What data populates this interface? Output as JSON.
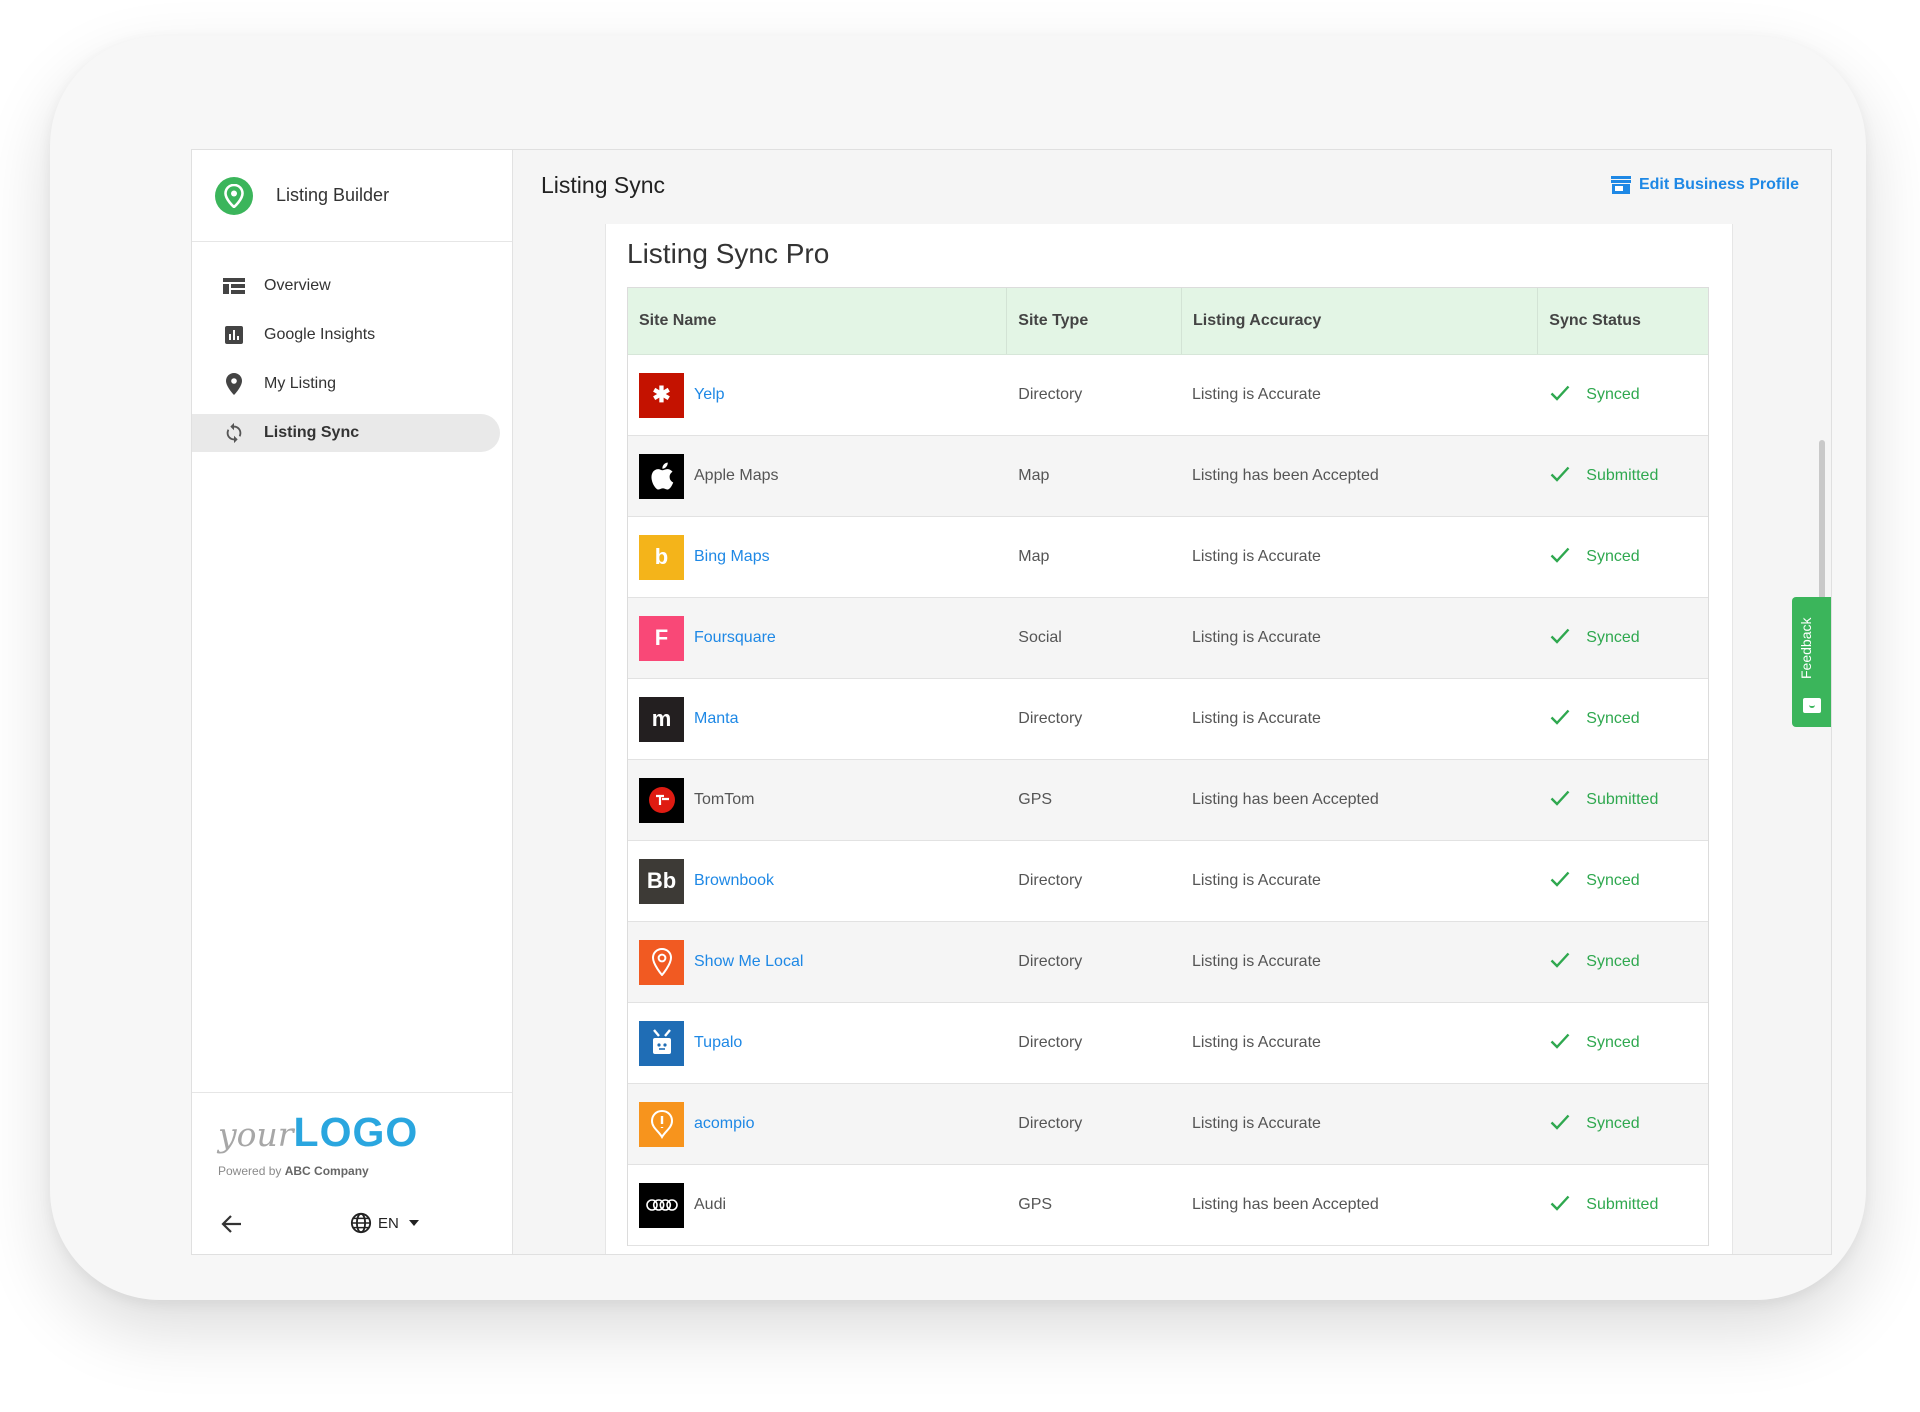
{
  "app": {
    "title": "Listing Builder"
  },
  "sidebar": {
    "items": [
      {
        "label": "Overview",
        "icon": "dashboard-icon"
      },
      {
        "label": "Google Insights",
        "icon": "bar-chart-icon"
      },
      {
        "label": "My Listing",
        "icon": "map-pin-icon"
      },
      {
        "label": "Listing Sync",
        "icon": "sync-icon",
        "active": true
      }
    ],
    "logo": {
      "your": "your",
      "big": "LOGO"
    },
    "powered_prefix": "Powered by",
    "powered_company": "ABC Company",
    "language": "EN"
  },
  "header": {
    "title": "Listing Sync",
    "edit_link": "Edit Business Profile"
  },
  "main": {
    "card_title": "Listing Sync Pro",
    "columns": [
      "Site Name",
      "Site Type",
      "Listing Accuracy",
      "Sync Status"
    ],
    "rows": [
      {
        "site": "Yelp",
        "type": "Directory",
        "accuracy": "Listing is Accurate",
        "status": "Synced",
        "logo_color": "#c41200",
        "logo_text": "✱",
        "link": true
      },
      {
        "site": "Apple Maps",
        "type": "Map",
        "accuracy": "Listing has been Accepted",
        "status": "Submitted",
        "logo_color": "#000000",
        "logo_text": "",
        "link": false
      },
      {
        "site": "Bing Maps",
        "type": "Map",
        "accuracy": "Listing is Accurate",
        "status": "Synced",
        "logo_color": "#f4b41a",
        "logo_text": "b",
        "link": true
      },
      {
        "site": "Foursquare",
        "type": "Social",
        "accuracy": "Listing is Accurate",
        "status": "Synced",
        "logo_color": "#f94877",
        "logo_text": "F",
        "link": true
      },
      {
        "site": "Manta",
        "type": "Directory",
        "accuracy": "Listing is Accurate",
        "status": "Synced",
        "logo_color": "#231f20",
        "logo_text": "m",
        "link": true
      },
      {
        "site": "TomTom",
        "type": "GPS",
        "accuracy": "Listing has been Accepted",
        "status": "Submitted",
        "logo_color": "#000000",
        "logo_text": "",
        "link": false
      },
      {
        "site": "Brownbook",
        "type": "Directory",
        "accuracy": "Listing is Accurate",
        "status": "Synced",
        "logo_color": "#3d3a36",
        "logo_text": "Bb",
        "link": true
      },
      {
        "site": "Show Me Local",
        "type": "Directory",
        "accuracy": "Listing is Accurate",
        "status": "Synced",
        "logo_color": "#f15a22",
        "logo_text": "",
        "link": true
      },
      {
        "site": "Tupalo",
        "type": "Directory",
        "accuracy": "Listing is Accurate",
        "status": "Synced",
        "logo_color": "#1f6db5",
        "logo_text": "",
        "link": true
      },
      {
        "site": "acompio",
        "type": "Directory",
        "accuracy": "Listing is Accurate",
        "status": "Synced",
        "logo_color": "#f7941d",
        "logo_text": "",
        "link": true
      },
      {
        "site": "Audi",
        "type": "GPS",
        "accuracy": "Listing has been Accepted",
        "status": "Submitted",
        "logo_color": "#000000",
        "logo_text": "",
        "link": false
      }
    ]
  },
  "feedback": {
    "label": "Feedback"
  },
  "colors": {
    "accent": "#1e88e5",
    "success": "#2fa84f",
    "brand_green": "#3bb55b",
    "header_green": "#e3f5e5"
  }
}
